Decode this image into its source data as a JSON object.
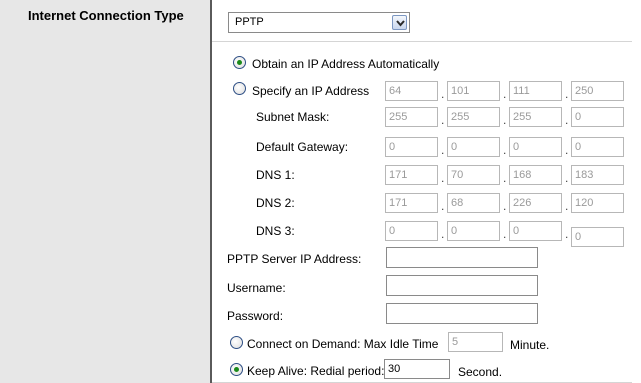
{
  "section": {
    "title": "Internet Connection Type"
  },
  "connection_type": {
    "selected": "PPTP"
  },
  "ip_mode": {
    "auto_label": "Obtain an IP Address Automatically",
    "auto_checked": true,
    "static_label": "Specify an IP Address",
    "static_checked": false
  },
  "static": {
    "ip": [
      "64",
      "101",
      "111",
      "250"
    ],
    "subnet_label": "Subnet Mask:",
    "subnet": [
      "255",
      "255",
      "255",
      "0"
    ],
    "gateway_label": "Default Gateway:",
    "gateway": [
      "0",
      "0",
      "0",
      "0"
    ],
    "dns1_label": "DNS 1:",
    "dns1": [
      "171",
      "70",
      "168",
      "183"
    ],
    "dns2_label": "DNS 2:",
    "dns2": [
      "171",
      "68",
      "226",
      "120"
    ],
    "dns3_label": "DNS 3:",
    "dns3": [
      "0",
      "0",
      "0",
      "0"
    ]
  },
  "pptp": {
    "server_label": "PPTP Server IP Address:",
    "server_value": "",
    "username_label": "Username:",
    "username_value": "",
    "password_label": "Password:",
    "password_value": ""
  },
  "connect_on_demand": {
    "label": "Connect on Demand: Max Idle Time",
    "value": "5",
    "unit": "Minute.",
    "checked": false
  },
  "keep_alive": {
    "label": "Keep Alive: Redial period:",
    "value": "30",
    "unit": "Second.",
    "checked": true
  },
  "colors": {
    "radio_dot": "#1b8a1b",
    "left_panel_bg": "#e7e7e7",
    "divider": "#5a5a5a"
  }
}
